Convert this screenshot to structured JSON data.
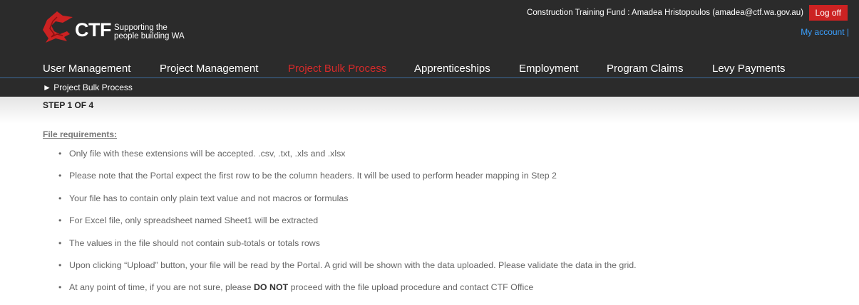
{
  "brand": {
    "ctf": "CTF",
    "tagline_line1": "Supporting the",
    "tagline_line2": "people building WA",
    "logo_color": "#cc2222"
  },
  "user": {
    "info": "Construction Training Fund : Amadea Hristopoulos (amadea@ctf.wa.gov.au)",
    "logoff_label": "Log off",
    "my_account_label": "My account |"
  },
  "nav": {
    "items": [
      {
        "label": "User Management"
      },
      {
        "label": "Project Management"
      },
      {
        "label": "Project Bulk Process",
        "active": true
      },
      {
        "label": "Apprenticeships"
      },
      {
        "label": "Employment"
      },
      {
        "label": "Program Claims"
      },
      {
        "label": "Levy Payments"
      }
    ]
  },
  "breadcrumb": "► Project Bulk Process",
  "step": "STEP 1 OF 4",
  "requirements": {
    "title": "File requirements:",
    "items": [
      "Only file with these extensions will be accepted. .csv, .txt, .xls and .xlsx",
      "Please note that the Portal expect the first row to be the column headers. It will be used to perform header mapping in Step 2",
      "Your file has to contain only plain text value and not macros or formulas",
      "For Excel file, only spreadsheet named Sheet1 will be extracted",
      "The values in the file should not contain sub-totals or totals rows",
      "Upon clicking “Upload” button, your file will be read by the Portal. A grid will be shown with the data uploaded. Please validate the data in the grid."
    ],
    "last_item": {
      "before": "At any point of time, if you are not sure, please ",
      "bold": "DO NOT",
      "after": " proceed with the file upload procedure and contact CTF Office"
    }
  },
  "colors": {
    "header_bg": "#2b2b2b",
    "accent_red": "#cc2222",
    "link_blue": "#3aa0ff"
  }
}
